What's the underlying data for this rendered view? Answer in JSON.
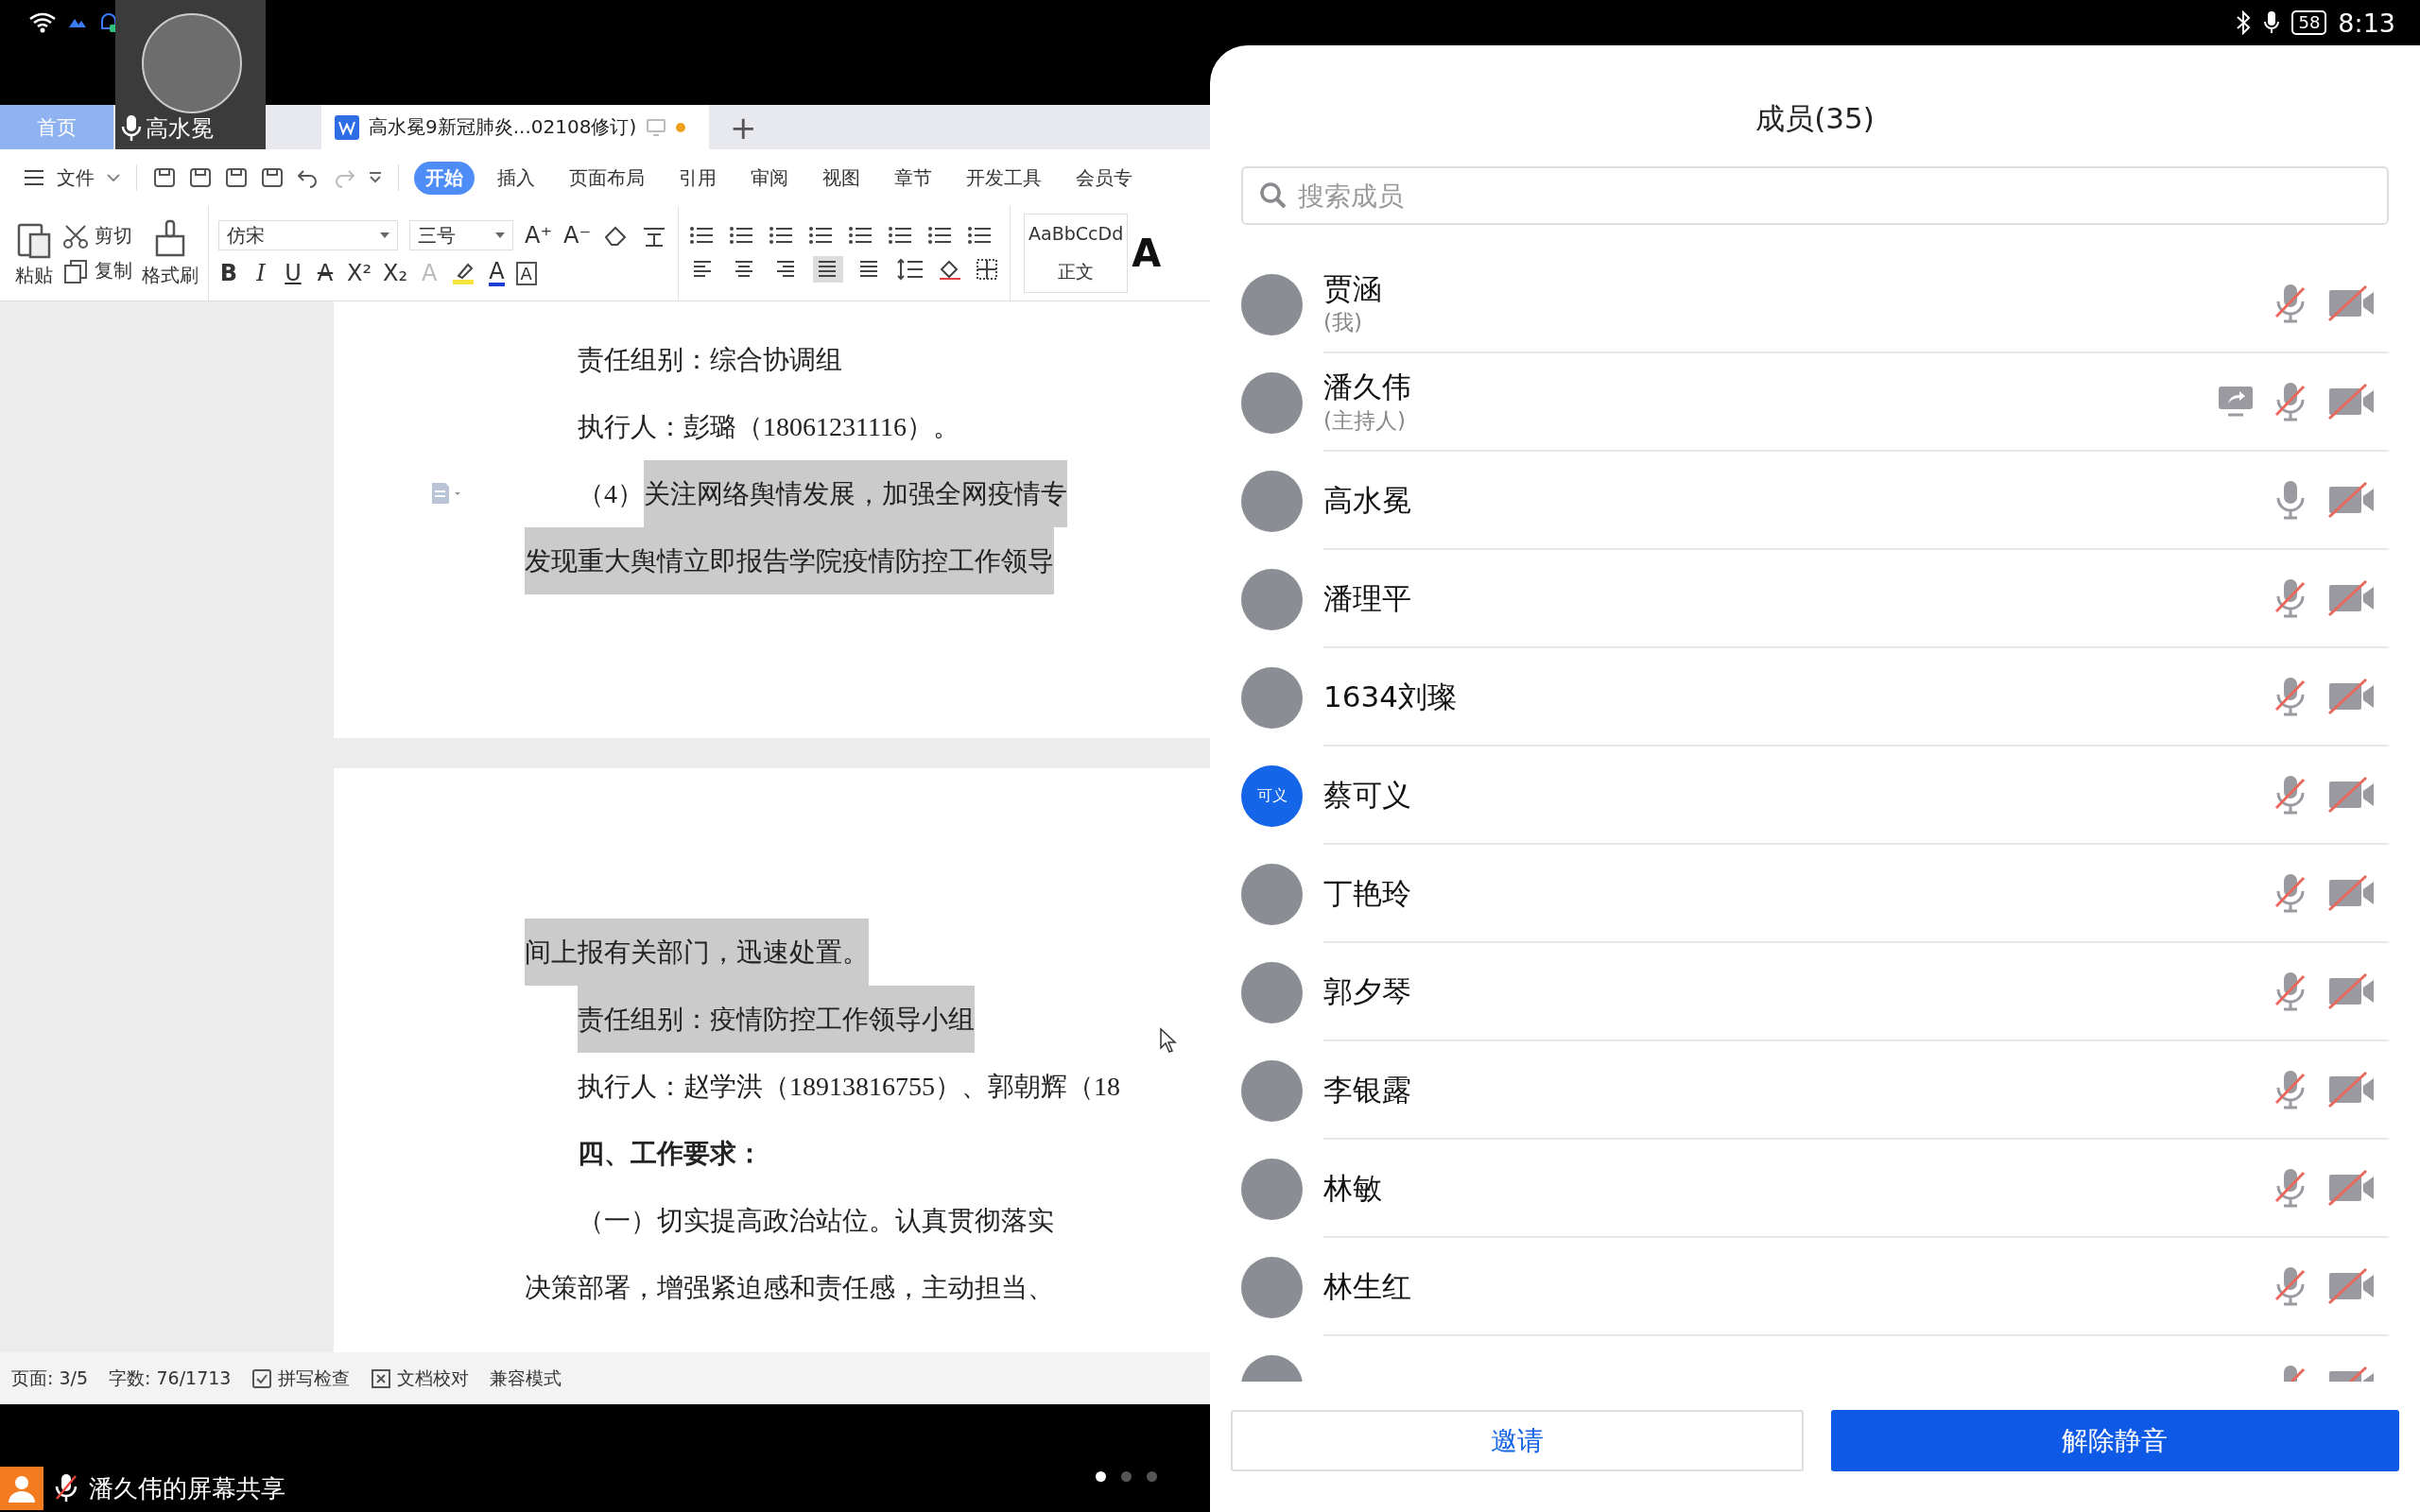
{
  "system_status": {
    "battery": "58",
    "time": "8:13"
  },
  "video_tile": {
    "name": "高水冕",
    "mic_muted": false
  },
  "wps": {
    "tabs": [
      {
        "label": "首页",
        "kind": "home",
        "selected": false
      },
      {
        "label": "高水冕9新冠肺炎...02108修订)",
        "kind": "document",
        "selected": true
      }
    ],
    "new_tab": "+",
    "file_menu": "文件",
    "ribbon_tabs": [
      {
        "label": "开始",
        "selected": true
      },
      {
        "label": "插入",
        "selected": false
      },
      {
        "label": "页面布局",
        "selected": false
      },
      {
        "label": "引用",
        "selected": false
      },
      {
        "label": "审阅",
        "selected": false
      },
      {
        "label": "视图",
        "selected": false
      },
      {
        "label": "章节",
        "selected": false
      },
      {
        "label": "开发工具",
        "selected": false
      },
      {
        "label": "会员专",
        "selected": false
      }
    ],
    "clipboard": {
      "paste": "粘贴",
      "cut": "剪切",
      "copy": "复制",
      "format_painter": "格式刷"
    },
    "font_name": "仿宋",
    "font_size": "三号",
    "size_buttons": [
      "A⁺",
      "A⁻"
    ],
    "format_buttons": [
      {
        "kind": "bold",
        "text": "B"
      },
      {
        "kind": "italic",
        "text": "I"
      },
      {
        "kind": "underline",
        "text": "U"
      },
      {
        "kind": "strike",
        "text": "A"
      },
      {
        "kind": "plain",
        "text": "X²"
      },
      {
        "kind": "plain",
        "text": "X₂"
      },
      {
        "kind": "effect",
        "text": "A"
      }
    ],
    "font_color_button": "A",
    "boxed_button": "A",
    "paragraph_align": [
      {
        "kind": "left",
        "selected": false
      },
      {
        "kind": "center",
        "selected": false
      },
      {
        "kind": "right",
        "selected": false
      },
      {
        "kind": "justify",
        "selected": true
      },
      {
        "kind": "distributed",
        "selected": false
      }
    ],
    "style_preview": {
      "preview": "AaBbCcDd",
      "label": "正文"
    },
    "next_style_preview": "A",
    "document": {
      "pages": [
        {
          "lines": [
            {
              "indent": true,
              "bold": false,
              "segments": [
                {
                  "text": "责任组别：综合协调组",
                  "highlighted": false
                }
              ]
            },
            {
              "indent": true,
              "bold": false,
              "segments": [
                {
                  "text": "执行人：彭璐（18061231116）。",
                  "highlighted": false
                }
              ]
            },
            {
              "indent": true,
              "bold": false,
              "comment": true,
              "segments": [
                {
                  "text": "（4）",
                  "highlighted": false
                },
                {
                  "text": "关注网络舆情发展，加强全网疫情专",
                  "highlighted": true
                }
              ]
            },
            {
              "indent": false,
              "bold": false,
              "segments": [
                {
                  "text": "发现重大舆情立即报告学院疫情防控工作领导",
                  "highlighted": true
                }
              ]
            }
          ]
        },
        {
          "lines": [
            {
              "indent": false,
              "bold": false,
              "segments": [
                {
                  "text": "间上报有关部门，迅速处置。",
                  "highlighted": true
                }
              ]
            },
            {
              "indent": true,
              "bold": false,
              "segments": [
                {
                  "text": "责任组别：疫情防控工作领导小组",
                  "highlighted": true
                }
              ]
            },
            {
              "indent": true,
              "bold": false,
              "segments": [
                {
                  "text": "执行人：赵学洪（18913816755）、郭朝辉（18",
                  "highlighted": false
                }
              ]
            },
            {
              "indent": true,
              "bold": true,
              "segments": [
                {
                  "text": "四、工作要求：",
                  "highlighted": false
                }
              ]
            },
            {
              "indent": true,
              "bold": false,
              "segments": [
                {
                  "text": "（一）切实提高政治站位。认真贯彻落实",
                  "highlighted": false
                }
              ]
            },
            {
              "indent": false,
              "bold": false,
              "segments": [
                {
                  "text": "决策部署，增强紧迫感和责任感，主动担当、",
                  "highlighted": false
                }
              ]
            }
          ]
        }
      ]
    },
    "status": [
      "页面: 3/5",
      "字数: 76/1713"
    ],
    "status_toggles": [
      {
        "label": "拼写检查",
        "kind": "check"
      },
      {
        "label": "文档校对",
        "kind": "proof"
      },
      {
        "label": "兼容模式",
        "kind": "plain"
      }
    ]
  },
  "share_bar": {
    "label": "潘久伟的屏幕共享",
    "mic_muted": true
  },
  "pager": [
    {
      "selected": true
    },
    {
      "selected": false
    },
    {
      "selected": false
    }
  ],
  "members_panel": {
    "title": "成员(35)",
    "search": {
      "placeholder": "搜索成员"
    },
    "members": [
      {
        "name": "贾涵",
        "role": "(我)",
        "sharing": false,
        "muted": true,
        "camera_on": false
      },
      {
        "name": "潘久伟",
        "role": "(主持人)",
        "sharing": true,
        "muted": true,
        "camera_on": false
      },
      {
        "name": "高水冕",
        "sharing": false,
        "muted": false,
        "camera_on": false
      },
      {
        "name": "潘理平",
        "sharing": false,
        "muted": true,
        "camera_on": false
      },
      {
        "name": "1634刘璨",
        "sharing": false,
        "muted": true,
        "camera_on": false
      },
      {
        "name": "蔡可义",
        "avatar_text": "可义",
        "sharing": false,
        "muted": true,
        "camera_on": false
      },
      {
        "name": "丁艳玲",
        "sharing": false,
        "muted": true,
        "camera_on": false
      },
      {
        "name": "郭夕琴",
        "sharing": false,
        "muted": true,
        "camera_on": false
      },
      {
        "name": "李银露",
        "sharing": false,
        "muted": true,
        "camera_on": false
      },
      {
        "name": "林敏",
        "sharing": false,
        "muted": true,
        "camera_on": false
      },
      {
        "name": "林生红",
        "sharing": false,
        "muted": true,
        "camera_on": false
      },
      {
        "sharing": false,
        "muted": true,
        "camera_on": false
      }
    ],
    "buttons": [
      {
        "label": "邀请",
        "kind": "secondary"
      },
      {
        "label": "解除静音",
        "kind": "primary"
      }
    ]
  }
}
